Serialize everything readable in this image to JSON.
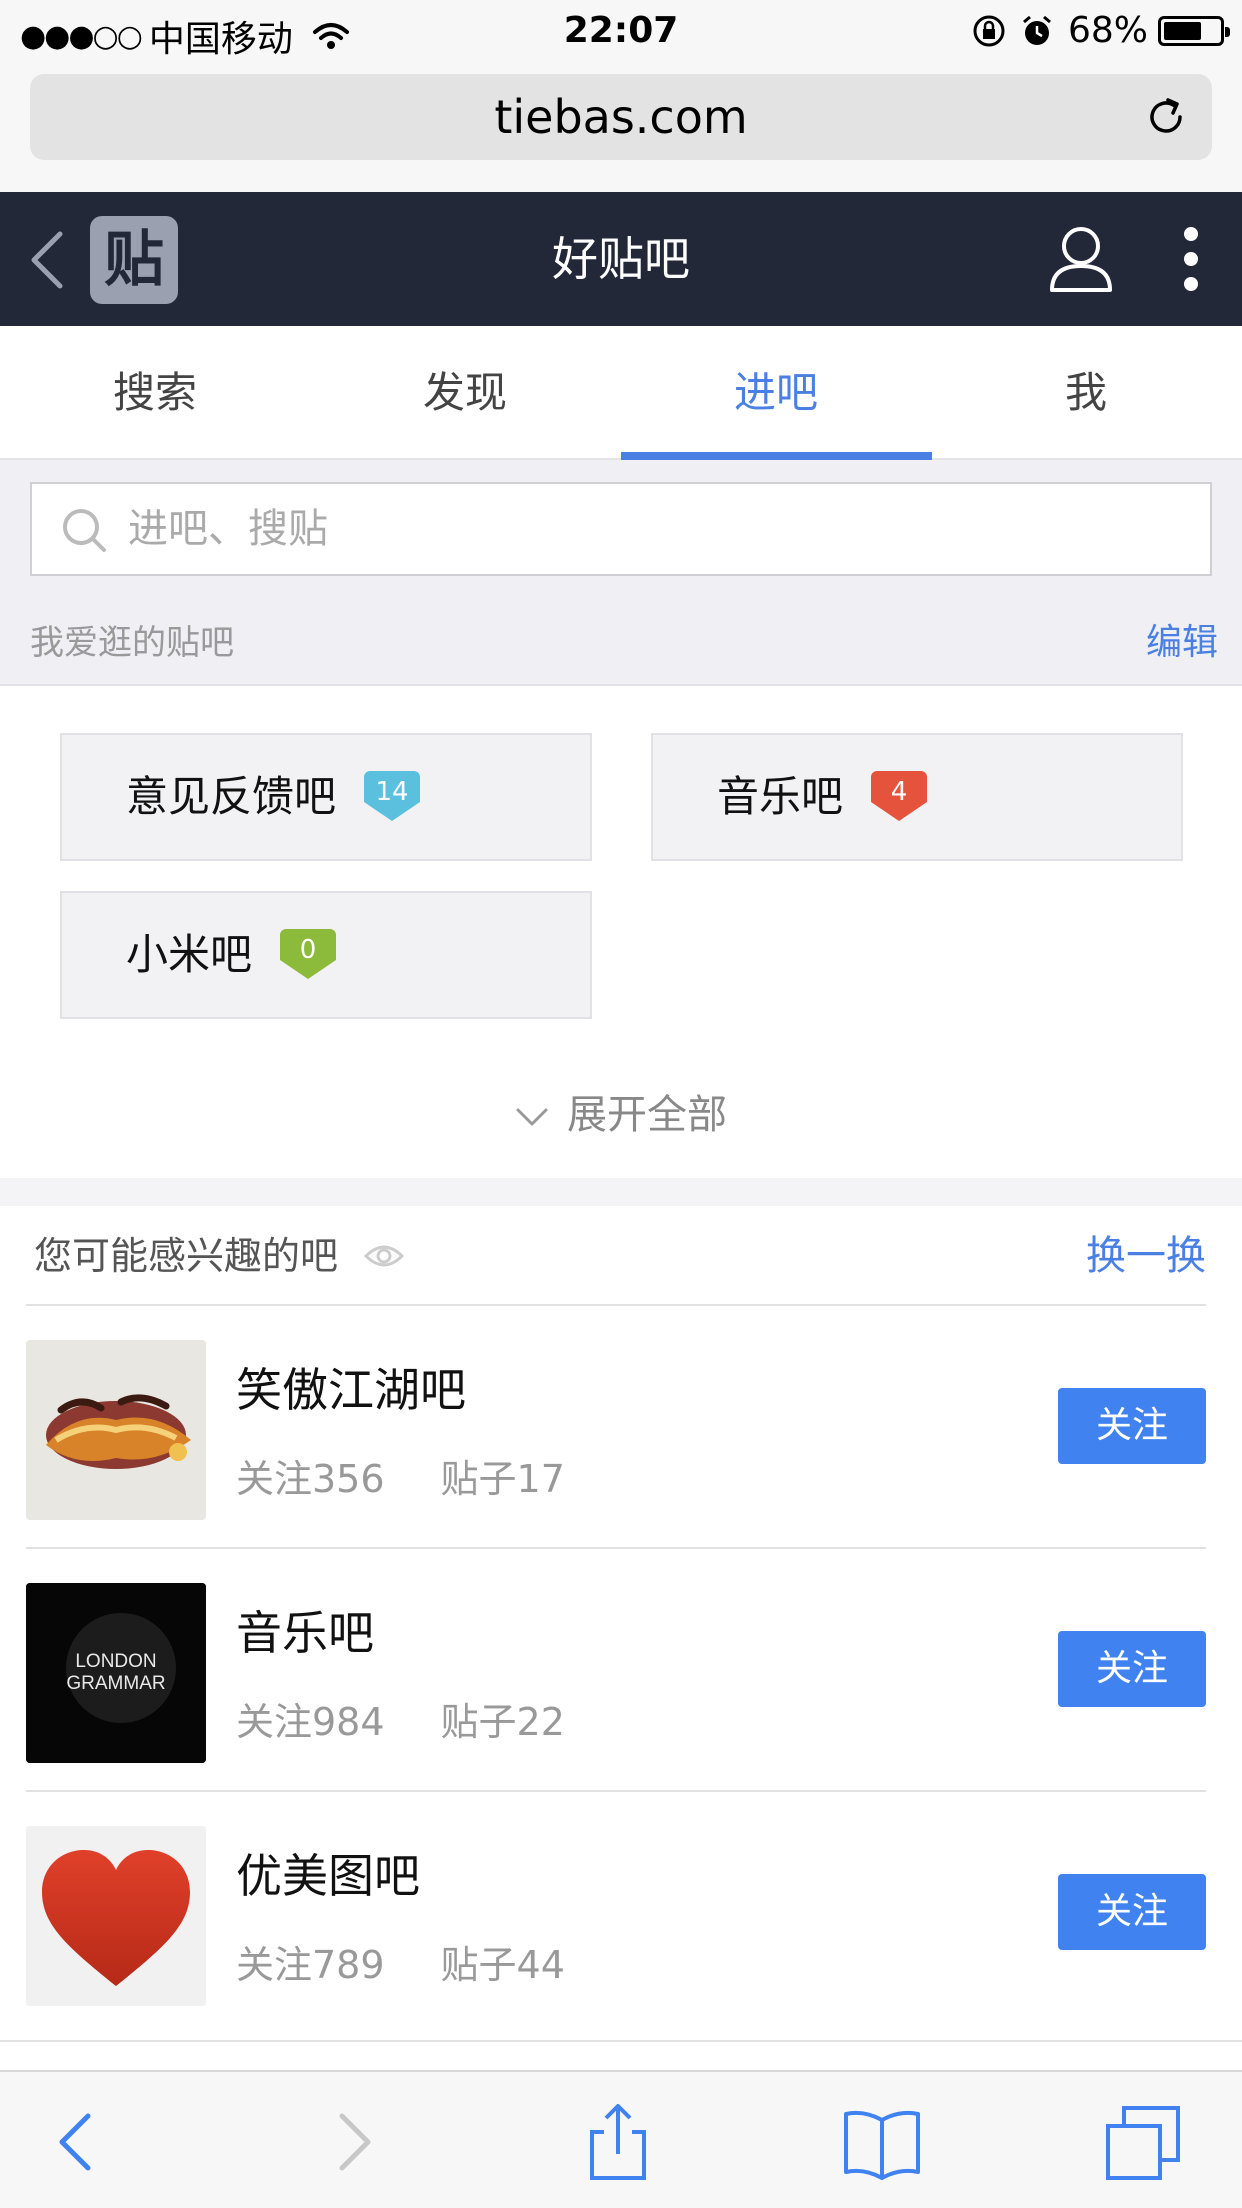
{
  "status_bar": {
    "signal": "●●●○○",
    "carrier": "中国移动",
    "time": "22:07",
    "battery": "68%",
    "battery_level": 0.68
  },
  "browser": {
    "url": "tiebas.com"
  },
  "header": {
    "logo_char": "贴",
    "title": "好贴吧"
  },
  "tabs": [
    {
      "label": "搜索",
      "active": false
    },
    {
      "label": "发现",
      "active": false
    },
    {
      "label": "进吧",
      "active": true
    },
    {
      "label": "我",
      "active": false
    }
  ],
  "search": {
    "placeholder": "进吧、搜贴"
  },
  "favorites": {
    "title": "我爱逛的贴吧",
    "edit_label": "编辑",
    "items": [
      {
        "name": "意见反馈吧",
        "badge": "14",
        "badge_color": "#5bc0de"
      },
      {
        "name": "音乐吧",
        "badge": "4",
        "badge_color": "#e5533d"
      },
      {
        "name": "小米吧",
        "badge": "0",
        "badge_color": "#8cba3a"
      }
    ],
    "expand_label": "展开全部"
  },
  "interest": {
    "title": "您可能感兴趣的吧",
    "refresh_label": "换一换",
    "items": [
      {
        "name": "笑傲江湖吧",
        "followers": "关注356",
        "posts": "贴子17",
        "button": "关注"
      },
      {
        "name": "音乐吧",
        "followers": "关注984",
        "posts": "贴子22",
        "button": "关注"
      },
      {
        "name": "优美图吧",
        "followers": "关注789",
        "posts": "贴子44",
        "button": "关注"
      }
    ],
    "thumb2_text": [
      "LONDON",
      "GRAMMAR"
    ]
  },
  "colors": {
    "accent": "#4a7fe4",
    "header_bg": "#232838",
    "follow_button": "#3f82f0"
  }
}
